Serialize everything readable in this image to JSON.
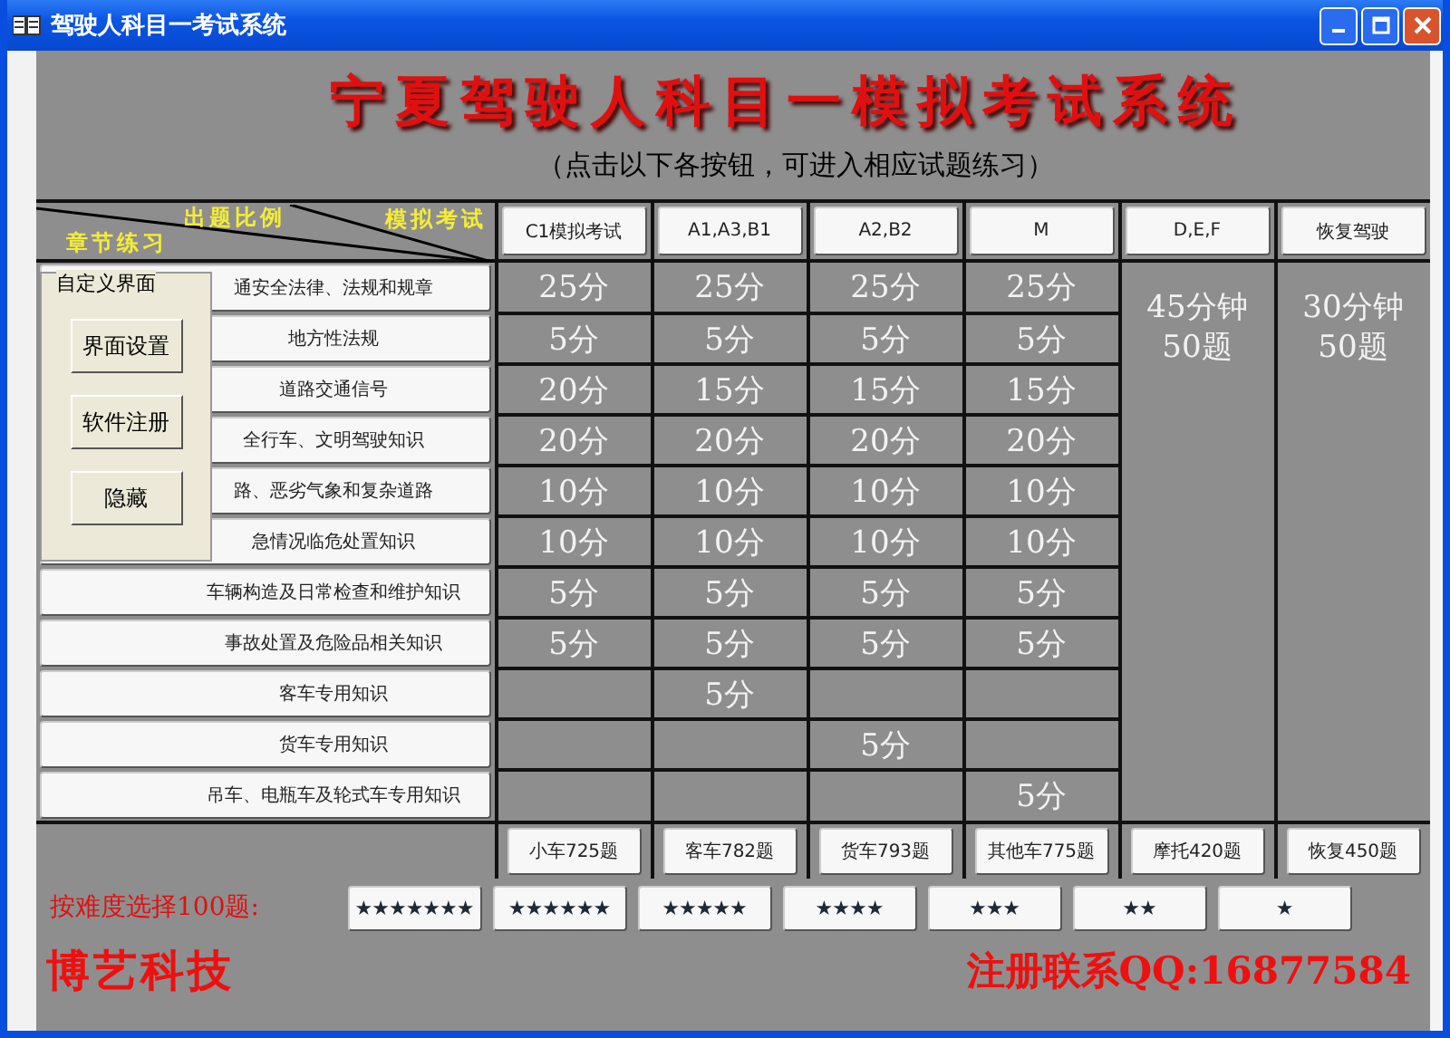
{
  "window": {
    "title": "驾驶人科目一考试系统"
  },
  "header": {
    "title": "宁夏驾驶人科目一模拟考试系统",
    "subtitle": "（点击以下各按钮，可进入相应试题练习）"
  },
  "corner_labels": {
    "ratio": "出题比例",
    "exam": "模拟考试",
    "chapter": "章节练习"
  },
  "exam_buttons": [
    "C1模拟考试",
    "A1,A3,B1",
    "A2,B2",
    "M",
    "D,E,F",
    "恢复驾驶"
  ],
  "chapters": [
    {
      "label": "通安全法律、法规和规章",
      "scores": {
        "c1": "25分",
        "a1": "25分",
        "a2": "25分",
        "m": "25分"
      }
    },
    {
      "label": "地方性法规",
      "scores": {
        "c1": "5分",
        "a1": "5分",
        "a2": "5分",
        "m": "5分"
      }
    },
    {
      "label": "道路交通信号",
      "scores": {
        "c1": "20分",
        "a1": "15分",
        "a2": "15分",
        "m": "15分"
      }
    },
    {
      "label": "全行车、文明驾驶知识",
      "scores": {
        "c1": "20分",
        "a1": "20分",
        "a2": "20分",
        "m": "20分"
      }
    },
    {
      "label": "路、恶劣气象和复杂道路",
      "scores": {
        "c1": "10分",
        "a1": "10分",
        "a2": "10分",
        "m": "10分"
      }
    },
    {
      "label": "急情况临危处置知识",
      "scores": {
        "c1": "10分",
        "a1": "10分",
        "a2": "10分",
        "m": "10分"
      }
    },
    {
      "label": "车辆构造及日常检查和维护知识",
      "scores": {
        "c1": "5分",
        "a1": "5分",
        "a2": "5分",
        "m": "5分"
      }
    },
    {
      "label": "事故处置及危险品相关知识",
      "scores": {
        "c1": "5分",
        "a1": "5分",
        "a2": "5分",
        "m": "5分"
      }
    },
    {
      "label": "客车专用知识",
      "scores": {
        "a1": "5分"
      }
    },
    {
      "label": "货车专用知识",
      "scores": {
        "a2": "5分"
      }
    },
    {
      "label": "吊车、电瓶车及轮式车专用知识",
      "scores": {
        "m": "5分"
      }
    }
  ],
  "timed_exams": [
    {
      "duration": "45分钟",
      "questions": "50题"
    },
    {
      "duration": "30分钟",
      "questions": "50题"
    }
  ],
  "bank_buttons": [
    "小车725题",
    "客车782题",
    "货车793题",
    "其他车775题",
    "摩托420题",
    "恢复450题"
  ],
  "difficulty": {
    "label": "按难度选择100题:",
    "buttons": [
      "★★★★★★★",
      "★★★★★★",
      "★★★★★",
      "★★★★",
      "★★★",
      "★★",
      "★"
    ]
  },
  "footer": {
    "company": "博艺科技",
    "contact": "注册联系QQ:16877584"
  },
  "custom_panel": {
    "title": "自定义界面",
    "buttons": [
      "界面设置",
      "软件注册",
      "隐藏"
    ]
  }
}
